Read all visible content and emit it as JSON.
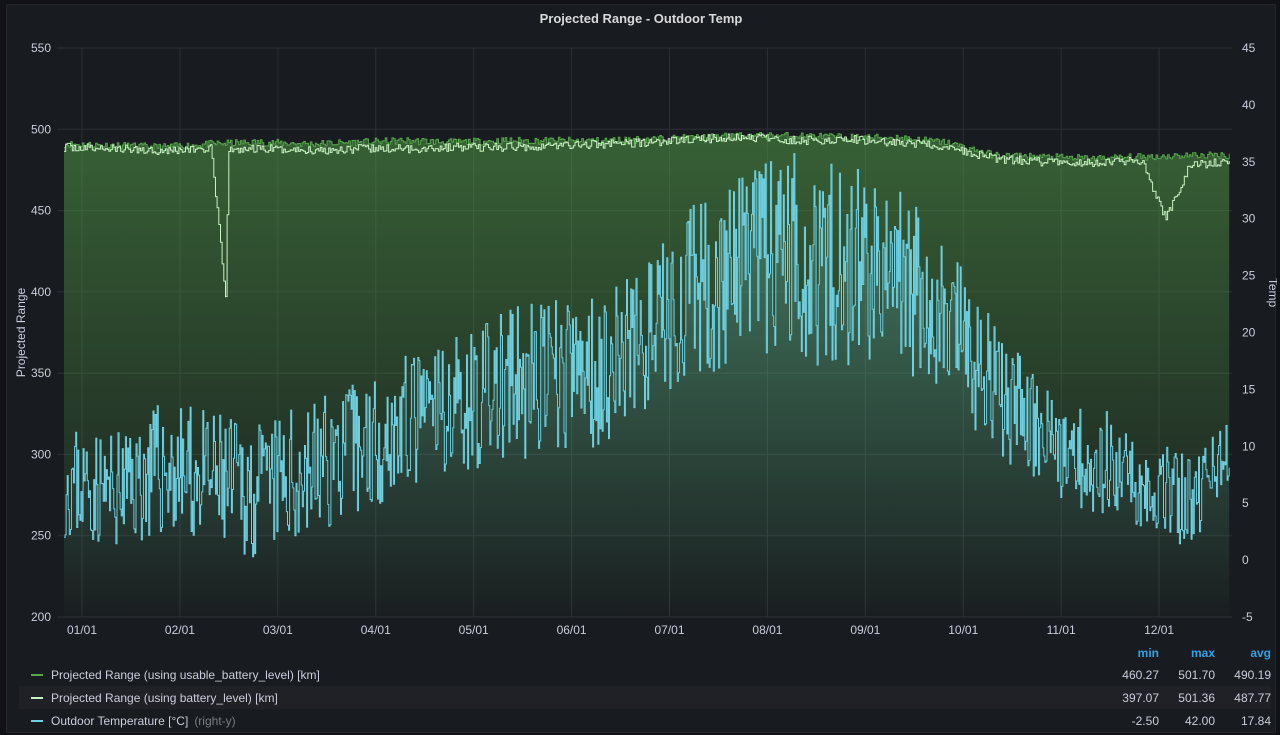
{
  "chart_data": {
    "type": "line",
    "title": "Projected Range - Outdoor Temp",
    "ylabel": "Projected Range",
    "ylabel_right": "Temp",
    "ylim": [
      200,
      550
    ],
    "ylim_right": [
      -5,
      45
    ],
    "y_ticks": [
      "200",
      "250",
      "300",
      "350",
      "400",
      "450",
      "500",
      "550"
    ],
    "y_ticks_right": [
      "-5",
      "0",
      "5",
      "10",
      "15",
      "20",
      "25",
      "30",
      "35",
      "40",
      "45"
    ],
    "x_ticks": [
      "01/01",
      "02/01",
      "03/01",
      "04/01",
      "05/01",
      "06/01",
      "07/01",
      "08/01",
      "09/01",
      "10/01",
      "11/01",
      "12/01"
    ],
    "grid": true,
    "legend_position": "bottom",
    "legend_columns": [
      "min",
      "max",
      "avg"
    ],
    "series": [
      {
        "name": "Projected Range (using usable_battery_level) [km]",
        "axis": "left",
        "color": "#56a64b",
        "min": "460.27",
        "max": "501.70",
        "avg": "490.19",
        "x_months": [
          0.0,
          0.5,
          1.0,
          1.5,
          2.0,
          2.5,
          3.0,
          3.5,
          4.0,
          4.5,
          5.0,
          5.5,
          6.0,
          6.5,
          7.0,
          7.5,
          8.0,
          8.5,
          9.0,
          9.5,
          10.0,
          10.5,
          11.0,
          11.5,
          11.9
        ],
        "values": [
          491,
          490,
          489,
          491,
          492,
          491,
          492,
          493,
          492,
          493,
          493,
          493,
          494,
          495,
          496,
          496,
          495,
          495,
          492,
          484,
          483,
          482,
          483,
          484,
          484
        ]
      },
      {
        "name": "Projected Range (using battery_level) [km]",
        "axis": "left",
        "color": "#c8f2c2",
        "min": "397.07",
        "max": "501.36",
        "avg": "487.77",
        "x_months": [
          0.0,
          0.5,
          1.0,
          1.5,
          1.65,
          1.68,
          2.0,
          2.5,
          3.0,
          3.5,
          4.0,
          4.5,
          5.0,
          5.5,
          6.0,
          6.5,
          7.0,
          7.5,
          8.0,
          8.5,
          9.0,
          9.5,
          10.0,
          10.5,
          11.0,
          11.25,
          11.5,
          11.9
        ],
        "values": [
          489,
          488,
          487,
          488,
          397,
          487,
          488,
          487,
          488,
          488,
          489,
          489,
          490,
          491,
          492,
          494,
          495,
          493,
          494,
          492,
          489,
          482,
          480,
          479,
          481,
          445,
          478,
          480
        ]
      },
      {
        "name": "Outdoor Temperature [°C]",
        "axis": "right",
        "axis_label": "(right-y)",
        "color": "#6ed0e0",
        "min": "-2.50",
        "max": "42.00",
        "avg": "17.84",
        "x_months": [
          0.0,
          0.5,
          1.0,
          1.5,
          2.0,
          2.5,
          3.0,
          3.5,
          4.0,
          4.5,
          5.0,
          5.5,
          6.0,
          6.5,
          7.0,
          7.5,
          8.0,
          8.5,
          9.0,
          9.5,
          10.0,
          10.5,
          11.0,
          11.5,
          11.9
        ],
        "values": [
          7,
          6,
          8,
          7,
          6,
          8,
          10,
          12,
          14,
          15,
          16,
          17,
          20,
          24,
          26,
          27,
          26,
          25,
          21,
          15,
          11,
          9,
          7,
          5,
          10
        ],
        "spread": [
          5,
          5,
          6,
          6,
          6,
          6,
          6,
          6,
          6,
          7,
          7,
          7,
          7,
          8,
          9,
          10,
          9,
          8,
          7,
          6,
          5,
          5,
          4,
          4,
          3
        ]
      }
    ]
  }
}
